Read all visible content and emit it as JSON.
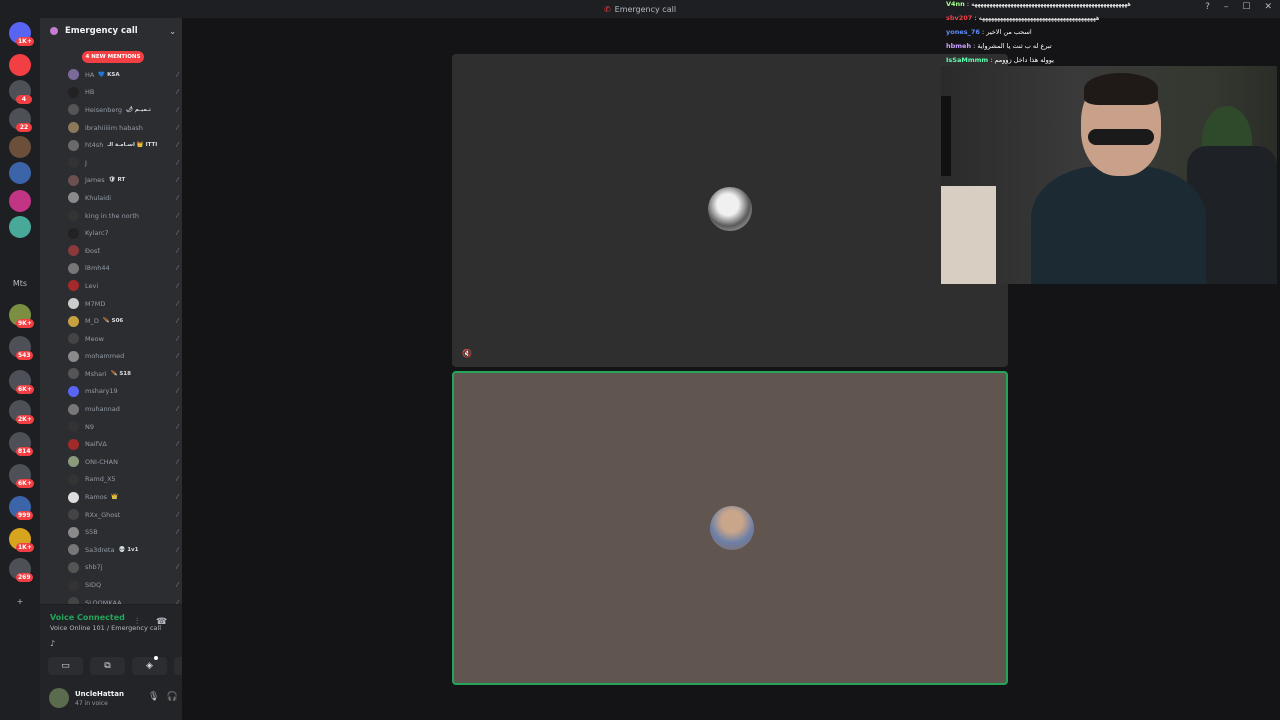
{
  "window": {
    "title": "Emergency call",
    "controls": {
      "help": "?",
      "minimize": "–",
      "maximize": "☐",
      "close": "✕"
    }
  },
  "servers": [
    {
      "badge": "1K+",
      "color": "#5865f2"
    },
    {
      "badge": "",
      "color": "#f23f43"
    },
    {
      "badge": "4",
      "color": "#4e5058"
    },
    {
      "badge": "22",
      "color": "#4e5058"
    },
    {
      "badge": "",
      "color": "#6b4f3a"
    },
    {
      "badge": "",
      "color": "#3c64a8"
    },
    {
      "badge": "",
      "color": "#c13584"
    },
    {
      "badge": "",
      "color": "#48a999"
    },
    {
      "label": "Mts"
    },
    {
      "badge": "9K+",
      "color": "#7a8f42"
    },
    {
      "badge": "543",
      "color": "#4e5058"
    },
    {
      "badge": "6K+",
      "color": "#4e5058"
    },
    {
      "badge": "2K+",
      "color": "#4e5058"
    },
    {
      "badge": "814",
      "color": "#4e5058"
    },
    {
      "badge": "6K+",
      "color": "#4e5058"
    },
    {
      "badge": "999",
      "color": "#3c64a8"
    },
    {
      "badge": "1K+",
      "color": "#d8a41e"
    },
    {
      "badge": "269",
      "color": "#4e5058"
    },
    {
      "label": "+"
    }
  ],
  "channel": {
    "name": "Emergency call",
    "mentions_label": "4 NEW MENTIONS"
  },
  "members": [
    {
      "name": "HA",
      "tag": "💙 KSA",
      "color": "#7a6a9a"
    },
    {
      "name": "HB",
      "tag": "",
      "color": "#222"
    },
    {
      "name": "Heisenberg",
      "tag": "🌶 تـميـم",
      "color": "#555"
    },
    {
      "name": "ibrahiiiiim habash",
      "tag": "",
      "color": "#8a7a5a"
    },
    {
      "name": "ht4sh",
      "tag": "اسـامـة الـ 👑 ITTI",
      "color": "#6a6a6a"
    },
    {
      "name": "J",
      "tag": "",
      "color": "#333"
    },
    {
      "name": "James",
      "tag": "🛡 RT",
      "color": "#6a5050"
    },
    {
      "name": "Khulaidi",
      "tag": "",
      "color": "#8a8a8a"
    },
    {
      "name": "king in the north",
      "tag": "",
      "color": "#333"
    },
    {
      "name": "Kylarc7",
      "tag": "",
      "color": "#222"
    },
    {
      "name": "Ɖosƭ",
      "tag": "",
      "color": "#8a3a3a"
    },
    {
      "name": "l8mh44",
      "tag": "",
      "color": "#777"
    },
    {
      "name": "Levi",
      "tag": "",
      "color": "#a32a2a"
    },
    {
      "name": "M7MD",
      "tag": "",
      "color": "#ccc"
    },
    {
      "name": "M_D",
      "tag": "🪶 S06",
      "color": "#c9a040"
    },
    {
      "name": "Meow",
      "tag": "",
      "color": "#444"
    },
    {
      "name": "mohammed",
      "tag": "",
      "color": "#8a8a8a"
    },
    {
      "name": "Mshari",
      "tag": "🪶 S18",
      "color": "#555"
    },
    {
      "name": "mshary19",
      "tag": "",
      "color": "#5865f2"
    },
    {
      "name": "muhannad",
      "tag": "",
      "color": "#777"
    },
    {
      "name": "N9",
      "tag": "",
      "color": "#333"
    },
    {
      "name": "NaifVΔ",
      "tag": "",
      "color": "#a32a2a"
    },
    {
      "name": "ONI-CHAN",
      "tag": "",
      "color": "#8a9a7a"
    },
    {
      "name": "Ramd_X5",
      "tag": "",
      "color": "#333"
    },
    {
      "name": "Ramos",
      "tag": "👑",
      "color": "#ddd"
    },
    {
      "name": "RXx_Ghost",
      "tag": "",
      "color": "#444"
    },
    {
      "name": "S5B",
      "tag": "",
      "color": "#8a8a8a"
    },
    {
      "name": "Sa3dreta",
      "tag": "💀 1v1",
      "color": "#777"
    },
    {
      "name": "shb7j",
      "tag": "",
      "color": "#555"
    },
    {
      "name": "SIDQ",
      "tag": "",
      "color": "#333"
    },
    {
      "name": "SLOOMKAA",
      "tag": "",
      "color": "#444"
    }
  ],
  "voice": {
    "status": "Voice Connected",
    "subtitle": "Voice Online 101 / Emergency call"
  },
  "user": {
    "name": "UncleHattan",
    "status": "47 in voice"
  },
  "chat": [
    {
      "user": "V4nn",
      "user_color": "#a5ff8a",
      "msg": "ههههههههههههههههههههههههههههههههههههههههههههههههههههه"
    },
    {
      "user": "sbv207",
      "user_color": "#f23f43",
      "msg": "هههههههههههههههههههههههههههههههههههههههه"
    },
    {
      "user": "yones_76",
      "user_color": "#5b8dff",
      "msg": "اسحب من الاخير"
    },
    {
      "user": "hbmeh",
      "user_color": "#c9a0ff",
      "msg": "تبرع له ب ثنت يا المشرواية"
    },
    {
      "user": "IsSaMmmm",
      "user_color": "#5dffb0",
      "msg": "يووله هذا داخل زوومم"
    }
  ]
}
